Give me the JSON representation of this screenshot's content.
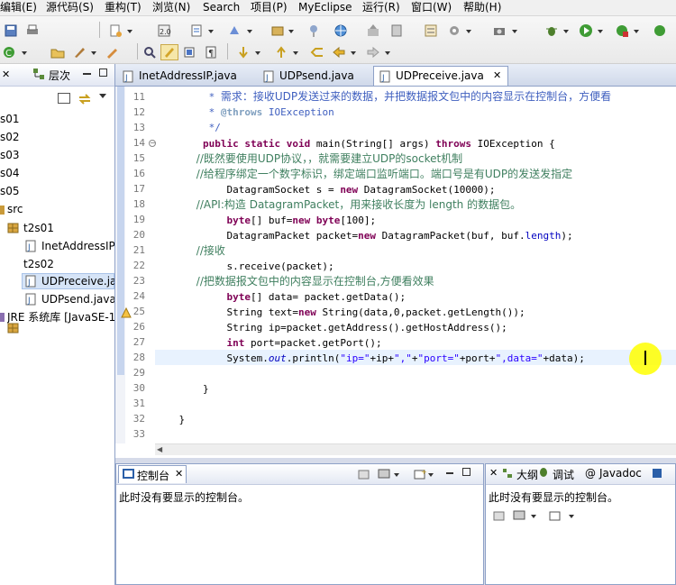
{
  "menu": [
    "编辑(E)",
    "源代码(S)",
    "重构(T)",
    "浏览(N)",
    "Search",
    "项目(P)",
    "MyEclipse",
    "运行(R)",
    "窗口(W)",
    "帮助(H)"
  ],
  "left_panel": {
    "tab_label": "层次",
    "items": [
      "s01",
      "s02",
      "s03",
      "s04",
      "s05",
      "src",
      "t2s01",
      "InetAddressIP",
      "t2s02",
      "UDPreceive.ja",
      "UDPsend.java",
      "JRE 系统库 [JavaSE-1"
    ]
  },
  "editor_tabs": [
    "InetAddressIP.java",
    "UDPsend.java",
    "UDPreceive.java"
  ],
  "code": {
    "line_numbers": [
      "11",
      "12",
      "13",
      "14",
      "15",
      "16",
      "17",
      "18",
      "19",
      "20",
      "21",
      "22",
      "23",
      "24",
      "25",
      "26",
      "27",
      "28",
      "29",
      "30",
      "31",
      "32",
      "33"
    ],
    "lines": {
      "l11_a": "         * ",
      "l11_b": "需求：接收UDP发送过来的数据，并把数据报文包中的内容显示在控制台，方便看",
      "l12_a": "         * ",
      "l12_b": "@throws",
      "l12_c": " IOException",
      "l13": "         */",
      "l14_a": "        ",
      "l14_b": "public static void",
      "l14_c": " main(String[] args) ",
      "l14_d": "throws",
      "l14_e": " IOException {",
      "l15": "            //既然要使用UDP协议，，就需要建立UDP的socket机制",
      "l16": "            //给程序绑定一个数字标识，绑定端口监听端口。端口号是有UDP的发送发指定",
      "l17_a": "            DatagramSocket s = ",
      "l17_b": "new",
      "l17_c": " DatagramSocket(10000);",
      "l18": "            //API:构造 DatagramPacket，用来接收长度为 length 的数据包。",
      "l19_a": "            ",
      "l19_b": "byte",
      "l19_c": "[] buf=",
      "l19_d": "new",
      "l19_e": " ",
      "l19_f": "byte",
      "l19_g": "[100];",
      "l20_a": "            DatagramPacket packet=",
      "l20_b": "new",
      "l20_c": " DatagramPacket(buf, buf.",
      "l20_d": "length",
      "l20_e": ");",
      "l21": "            //接收",
      "l22": "            s.receive(packet);",
      "l23": "            //把数据报文包中的内容显示在控制台,方便看效果",
      "l24_a": "            ",
      "l24_b": "byte",
      "l24_c": "[] data= packet.getData();",
      "l25_a": "            String text=",
      "l25_b": "new",
      "l25_c": " String(data,0,packet.getLength());",
      "l26": "            String ip=packet.getAddress().getHostAddress();",
      "l27_a": "            ",
      "l27_b": "int",
      "l27_c": " port=packet.getPort();",
      "l28_a": "            System.",
      "l28_b": "out",
      "l28_c": ".println(",
      "l28_d": "\"ip=\"",
      "l28_e": "+ip+",
      "l28_f": "\",\"",
      "l28_g": "+",
      "l28_h": "\"port=\"",
      "l28_i": "+port+",
      "l28_j": "\",data=\"",
      "l28_k": "+data);",
      "l30": "        }",
      "l32": "    }"
    }
  },
  "console_panel": {
    "tab_label": "控制台",
    "message": "此时没有要显示的控制台。"
  },
  "right_panel": {
    "tabs": [
      "大纲",
      "调试",
      "Javadoc"
    ],
    "message": "此时没有要显示的控制台。"
  },
  "colors": {
    "keyword": "#7f0055",
    "comment": "#3f7f5f",
    "javadoc": "#3f5fbf",
    "string": "#2a00ff",
    "current_line": "#e8f2fe",
    "cursor_highlight": "#ffff00"
  }
}
